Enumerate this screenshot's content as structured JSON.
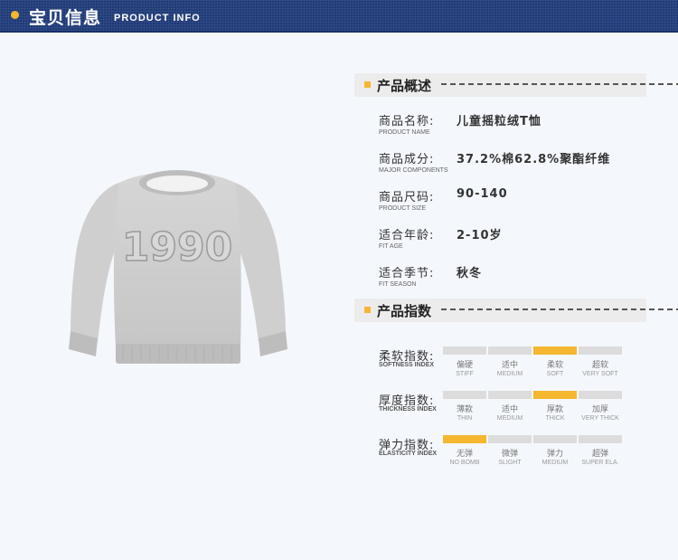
{
  "header": {
    "title": "宝贝信息",
    "subtitle": "PRODUCT INFO"
  },
  "product_image": {
    "print_text": "1990"
  },
  "overview": {
    "label": "产品概述",
    "rows": [
      {
        "cn": "商品名称:",
        "en": "PRODUCT NAME",
        "value": "儿童摇粒绒T恤"
      },
      {
        "cn": "商品成分:",
        "en": "MAJOR COMPONENTS",
        "value": "37.2%棉62.8%聚酯纤维"
      },
      {
        "cn": "商品尺码:",
        "en": "PRODUCT SIZE",
        "value": "90-140"
      },
      {
        "cn": "适合年龄:",
        "en": "FIT AGE",
        "value": "2-10岁"
      },
      {
        "cn": "适合季节:",
        "en": "FIT SEASON",
        "value": "秋冬"
      }
    ]
  },
  "indices": {
    "label": "产品指数",
    "rows": [
      {
        "cn": "柔软指数:",
        "en": "SOFTNESS INDEX",
        "selected": 2,
        "options": [
          {
            "cn": "偏硬",
            "en": "STIFF"
          },
          {
            "cn": "适中",
            "en": "MEDIUM"
          },
          {
            "cn": "柔软",
            "en": "SOFT"
          },
          {
            "cn": "超软",
            "en": "VERY SOFT"
          }
        ]
      },
      {
        "cn": "厚度指数:",
        "en": "THICKNESS INDEX",
        "selected": 2,
        "options": [
          {
            "cn": "薄款",
            "en": "THIN"
          },
          {
            "cn": "适中",
            "en": "MEDIUM"
          },
          {
            "cn": "厚款",
            "en": "THICK"
          },
          {
            "cn": "加厚",
            "en": "VERY THICK"
          }
        ]
      },
      {
        "cn": "弹力指数:",
        "en": "ELASTICITY INDEX",
        "selected": 0,
        "options": [
          {
            "cn": "无弹",
            "en": "NO BOMB"
          },
          {
            "cn": "微弹",
            "en": "SLIGHT"
          },
          {
            "cn": "弹力",
            "en": "MEDIUM"
          },
          {
            "cn": "超弹",
            "en": "SUPER ELA."
          }
        ]
      }
    ]
  },
  "colors": {
    "accent": "#f5b630",
    "header_bg": "#1f3a78",
    "bar_off": "#dcdcdc"
  }
}
